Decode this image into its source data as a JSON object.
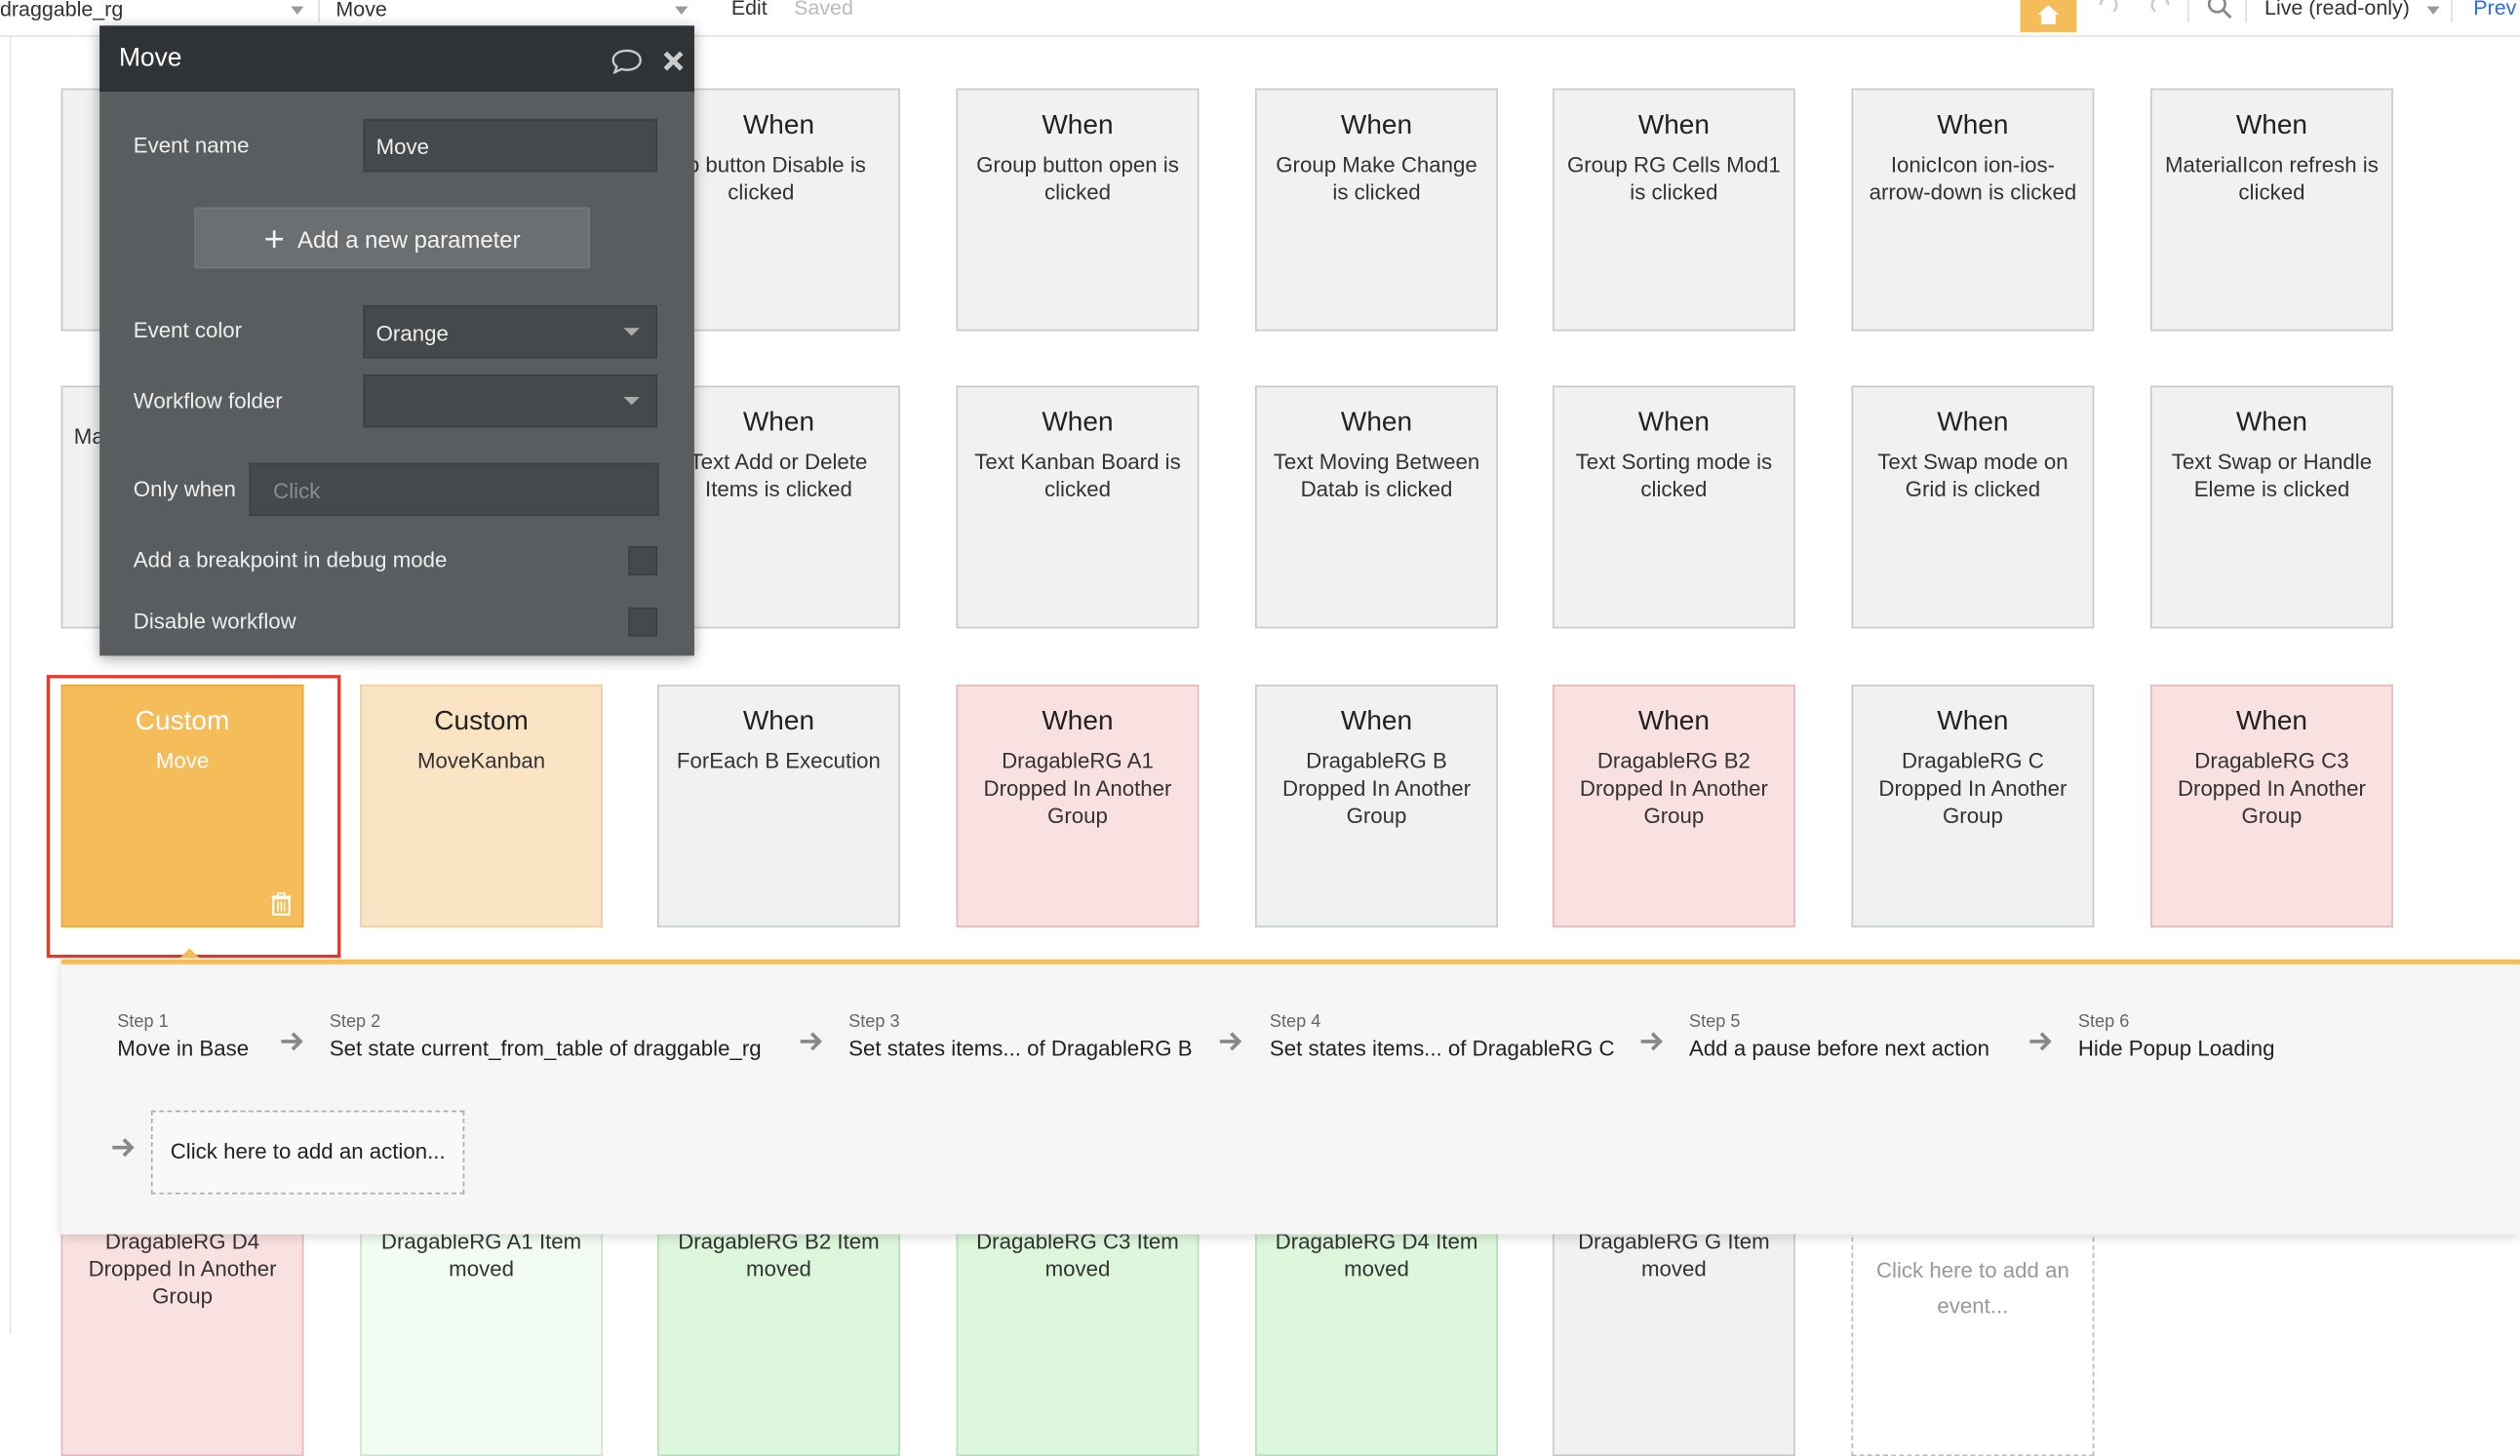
{
  "topbar": {
    "page_select": "draggable_rg",
    "event_select": "Move",
    "edit_label": "Edit",
    "saved_label": "Saved",
    "mode_select": "Live (read-only)",
    "preview_label": "Prev"
  },
  "dialog": {
    "title": "Move",
    "event_name_label": "Event name",
    "event_name_value": "Move",
    "add_param_label": "Add a new parameter",
    "event_color_label": "Event color",
    "event_color_value": "Orange",
    "workflow_folder_label": "Workflow folder",
    "workflow_folder_value": "",
    "only_when_label": "Only when",
    "only_when_placeholder": "Click",
    "breakpoint_label": "Add a breakpoint in debug mode",
    "disable_label": "Disable workflow"
  },
  "row1": [
    {
      "t1": "",
      "t2": ""
    },
    {
      "t1": "When",
      "t2": "roup button Disable is clicked"
    },
    {
      "t1": "When",
      "t2": "Group button open is clicked"
    },
    {
      "t1": "When",
      "t2": "Group Make Change is clicked"
    },
    {
      "t1": "When",
      "t2": "Group RG Cells Mod1 is clicked"
    },
    {
      "t1": "When",
      "t2": "IonicIcon ion-ios-arrow-down is clicked"
    },
    {
      "t1": "When",
      "t2": "MaterialIcon refresh is clicked"
    }
  ],
  "row2": [
    {
      "t1": "",
      "t2": "Ma"
    },
    {
      "t1": "When",
      "t2": "Text Add or Delete Items is clicked"
    },
    {
      "t1": "When",
      "t2": "Text Kanban Board is clicked"
    },
    {
      "t1": "When",
      "t2": "Text Moving Between Datab is clicked"
    },
    {
      "t1": "When",
      "t2": "Text Sorting mode is clicked"
    },
    {
      "t1": "When",
      "t2": "Text Swap mode on Grid is clicked"
    },
    {
      "t1": "When",
      "t2": "Text Swap or Handle Eleme is clicked"
    }
  ],
  "row3": [
    {
      "t1": "Custom",
      "t2": "Move"
    },
    {
      "t1": "Custom",
      "t2": "MoveKanban"
    },
    {
      "t1": "When",
      "t2": "ForEach B Execution"
    },
    {
      "t1": "When",
      "t2": "DragableRG A1 Dropped In Another Group"
    },
    {
      "t1": "When",
      "t2": "DragableRG B Dropped In Another Group"
    },
    {
      "t1": "When",
      "t2": "DragableRG B2 Dropped In Another Group"
    },
    {
      "t1": "When",
      "t2": "DragableRG C Dropped In Another Group"
    },
    {
      "t1": "When",
      "t2": "DragableRG C3 Dropped In Another Group"
    }
  ],
  "row4": [
    {
      "t2": "DragableRG D4 Dropped In Another Group"
    },
    {
      "t2": "DragableRG A1 Item moved"
    },
    {
      "t2": "DragableRG B2 Item moved"
    },
    {
      "t2": "DragableRG C3 Item moved"
    },
    {
      "t2": "DragableRG D4 Item moved"
    },
    {
      "t2": "DragableRG G Item moved"
    },
    {
      "t2": "Click here to add an event..."
    }
  ],
  "workflow": {
    "steps": [
      {
        "label": "Step 1",
        "value": "Move in Base"
      },
      {
        "label": "Step 2",
        "value": "Set state current_from_table of draggable_rg"
      },
      {
        "label": "Step 3",
        "value": "Set states items... of DragableRG B"
      },
      {
        "label": "Step 4",
        "value": "Set states items... of DragableRG C"
      },
      {
        "label": "Step 5",
        "value": "Add a pause before next action"
      },
      {
        "label": "Step 6",
        "value": "Hide Popup Loading"
      }
    ],
    "add_action": "Click here to add an action..."
  },
  "colors": {
    "accent": "#f5bc5a",
    "selection": "#e03b2b",
    "dialog_bg": "#595d5f",
    "dialog_header": "#2f3335"
  }
}
